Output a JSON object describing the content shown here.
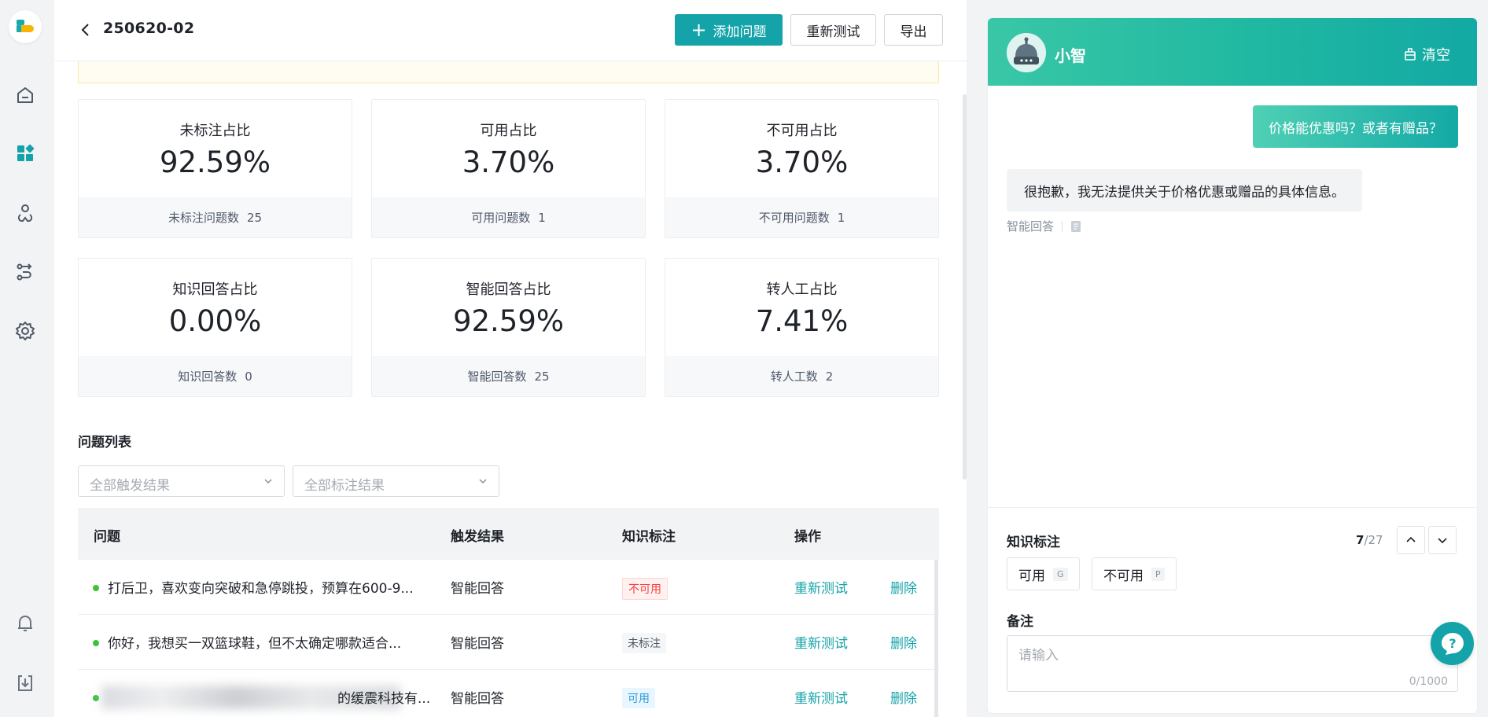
{
  "header": {
    "title": "250620-02",
    "add_label": "添加问题",
    "retest_label": "重新测试",
    "export_label": "导出"
  },
  "stats": [
    {
      "label": "未标注占比",
      "value": "92.59%",
      "foot_label": "未标注问题数",
      "foot_value": "25"
    },
    {
      "label": "可用占比",
      "value": "3.70%",
      "foot_label": "可用问题数",
      "foot_value": "1"
    },
    {
      "label": "不可用占比",
      "value": "3.70%",
      "foot_label": "不可用问题数",
      "foot_value": "1"
    },
    {
      "label": "知识回答占比",
      "value": "0.00%",
      "foot_label": "知识回答数",
      "foot_value": "0"
    },
    {
      "label": "智能回答占比",
      "value": "92.59%",
      "foot_label": "智能回答数",
      "foot_value": "25"
    },
    {
      "label": "转人工占比",
      "value": "7.41%",
      "foot_label": "转人工数",
      "foot_value": "2"
    }
  ],
  "list": {
    "title": "问题列表",
    "filter1_placeholder": "全部触发结果",
    "filter2_placeholder": "全部标注结果",
    "columns": [
      "问题",
      "触发结果",
      "知识标注",
      "操作"
    ],
    "rows": [
      {
        "question": "打后卫，喜欢变向突破和急停跳投，预算在600-9...",
        "trigger": "智能回答",
        "tag": "不可用",
        "retest": "重新测试",
        "delete": "删除"
      },
      {
        "question": "你好，我想买一双篮球鞋，但不太确定哪款适合...",
        "trigger": "智能回答",
        "tag": "未标注",
        "retest": "重新测试",
        "delete": "删除"
      },
      {
        "question": "的缓震科技有...",
        "trigger": "智能回答",
        "tag": "可用",
        "retest": "重新测试",
        "delete": "删除"
      }
    ]
  },
  "chat": {
    "bot_name": "小智",
    "clear_label": "清空",
    "user_msg": "价格能优惠吗？或者有赠品？",
    "bot_msg": "很抱歉，我无法提供关于价格优惠或赠品的具体信息。",
    "bot_meta": "智能回答",
    "knowledge_label": "知识标注",
    "counter_current": "7",
    "counter_total": "/27",
    "opt_good": "可用",
    "opt_good_key": "G",
    "opt_bad": "不可用",
    "opt_bad_key": "P",
    "remark_label": "备注",
    "remark_placeholder": "请输入",
    "remark_count": "0/1000"
  },
  "colors": {
    "accent": "#13a3a9",
    "ok_dot": "#3cc23c"
  }
}
